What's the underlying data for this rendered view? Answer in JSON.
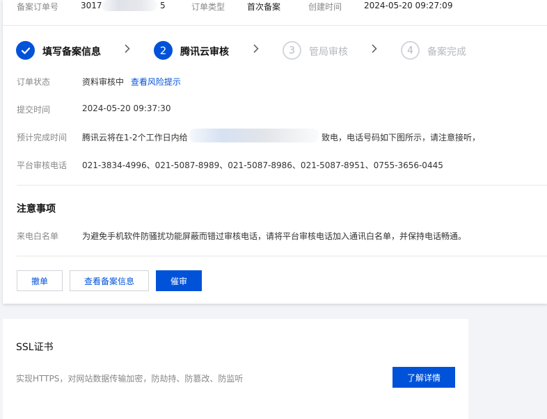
{
  "info_bar": {
    "order_no_label": "备案订单号",
    "order_no_prefix": "3017",
    "order_no_suffix": "5",
    "order_type_label": "订单类型",
    "order_type_value": "首次备案",
    "created_label": "创建时间",
    "created_value": "2024-05-20 09:27:09"
  },
  "steps": [
    {
      "label": "填写备案信息",
      "state": "done",
      "icon": "check-icon"
    },
    {
      "label": "腾讯云审核",
      "state": "active",
      "number": "2"
    },
    {
      "label": "管局审核",
      "state": "todo",
      "number": "3"
    },
    {
      "label": "备案完成",
      "state": "todo",
      "number": "4"
    }
  ],
  "details": {
    "status_label": "订单状态",
    "status_value": "资料审核中",
    "status_link": "查看风险提示",
    "submit_label": "提交时间",
    "submit_value": "2024-05-20 09:37:30",
    "eta_label": "预计完成时间",
    "eta_value_before": "腾讯云将在1-2个工作日内给",
    "eta_value_after": "致电，电话号码如下图所示，请注意接听，",
    "phone_label": "平台审核电话",
    "phone_value": "021-3834-4996、021-5087-8989、021-5087-8986、021-5087-8951、0755-3656-0445"
  },
  "notice": {
    "title": "注意事项",
    "whitelist_label": "来电白名单",
    "whitelist_value": "为避免手机软件防骚扰功能屏蔽而错过审核电话，请将平台审核电话加入通讯白名单，并保持电话畅通。"
  },
  "actions": {
    "withdraw": "撤单",
    "view_info": "查看备案信息",
    "urge": "催审"
  },
  "ssl": {
    "title": "SSL证书",
    "desc": "实现HTTPS，对网站数据传输加密，防劫持、防篡改、防监听",
    "button": "了解详情"
  },
  "colors": {
    "primary": "#0052d9",
    "step_todo": "#b5b8bf"
  }
}
